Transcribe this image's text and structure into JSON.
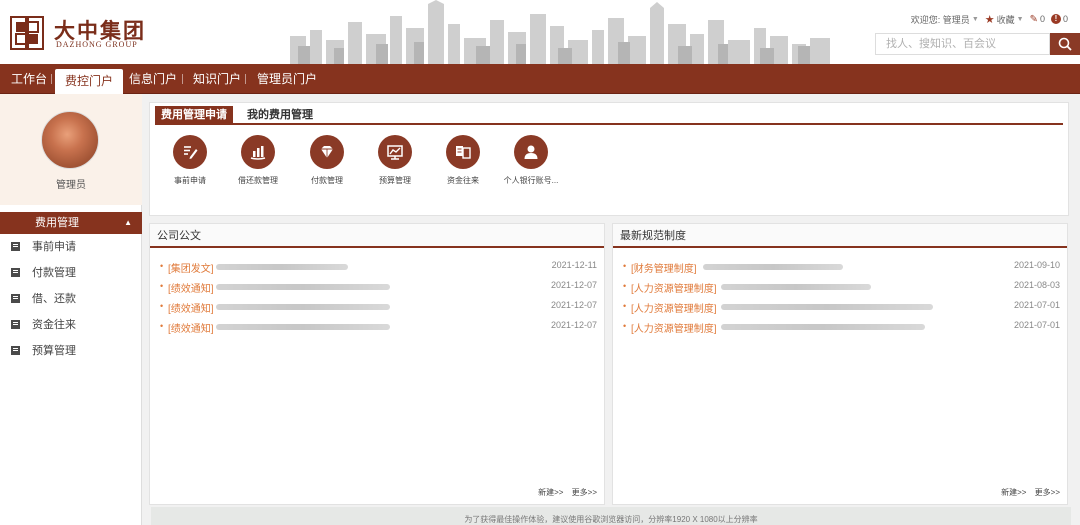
{
  "brand": {
    "name_cn": "大中集团",
    "name_en": "DAZHONG GROUP",
    "color": "#86331e"
  },
  "user_bar": {
    "welcome": "欢迎您: 管理员",
    "favorites_label": "收藏",
    "edit_count": "0",
    "alert_count": "0"
  },
  "search": {
    "placeholder": "找人、搜知识、百会议"
  },
  "nav": {
    "items": [
      {
        "label": "工作台",
        "active": false
      },
      {
        "label": "费控门户",
        "active": true
      },
      {
        "label": "信息门户",
        "active": false
      },
      {
        "label": "知识门户",
        "active": false
      },
      {
        "label": "管理员门户",
        "active": false
      }
    ]
  },
  "sidebar": {
    "profile_name": "管理员",
    "menu_header": "费用管理",
    "items": [
      {
        "label": "事前申请"
      },
      {
        "label": "付款管理"
      },
      {
        "label": "借、还款"
      },
      {
        "label": "资金往来"
      },
      {
        "label": "预算管理"
      }
    ]
  },
  "apps": {
    "tabs": [
      {
        "label": "费用管理申请",
        "active": true
      },
      {
        "label": "我的费用管理",
        "active": false
      }
    ],
    "items": [
      {
        "label": "事前申请",
        "icon": "pen-edit-icon"
      },
      {
        "label": "借还款管理",
        "icon": "hand-money-icon"
      },
      {
        "label": "付款管理",
        "icon": "diamond-icon"
      },
      {
        "label": "预算管理",
        "icon": "chart-board-icon"
      },
      {
        "label": "资金往来",
        "icon": "exchange-docs-icon"
      },
      {
        "label": "个人银行账号...",
        "icon": "person-icon"
      }
    ]
  },
  "announcements": {
    "title": "公司公文",
    "rows": [
      {
        "category": "[集团发文]",
        "date": "2021-12-11"
      },
      {
        "category": "[绩效通知]",
        "date": "2021-12-07"
      },
      {
        "category": "[绩效通知]",
        "date": "2021-12-07"
      },
      {
        "category": "[绩效通知]",
        "date": "2021-12-07"
      }
    ],
    "new_label": "新建>>",
    "more_label": "更多>>"
  },
  "regulations": {
    "title": "最新规范制度",
    "rows": [
      {
        "category": "[财务管理制度]",
        "date": "2021-09-10"
      },
      {
        "category": "[人力资源管理制度]",
        "date": "2021-08-03"
      },
      {
        "category": "[人力资源管理制度]",
        "date": "2021-07-01"
      },
      {
        "category": "[人力资源管理制度]",
        "date": "2021-07-01"
      }
    ],
    "new_label": "新建>>",
    "more_label": "更多>>"
  },
  "footer": {
    "text": "为了获得最佳操作体验，建议使用谷歌浏览器访问，分辨率1920 X 1080以上分辨率"
  }
}
